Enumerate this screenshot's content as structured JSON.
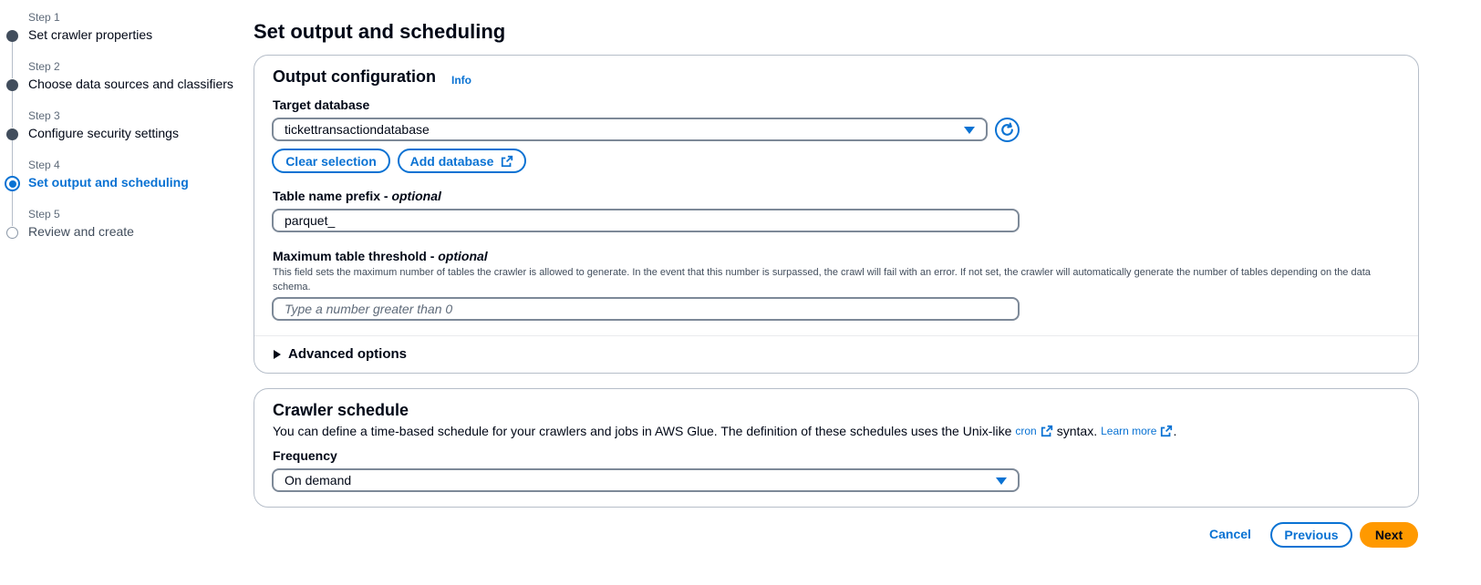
{
  "sidebar": {
    "steps": [
      {
        "number": "Step 1",
        "title": "Set crawler properties",
        "state": "done"
      },
      {
        "number": "Step 2",
        "title": "Choose data sources and classifiers",
        "state": "done"
      },
      {
        "number": "Step 3",
        "title": "Configure security settings",
        "state": "done"
      },
      {
        "number": "Step 4",
        "title": "Set output and scheduling",
        "state": "active"
      },
      {
        "number": "Step 5",
        "title": "Review and create",
        "state": "future"
      }
    ]
  },
  "page_title": "Set output and scheduling",
  "output_config": {
    "heading": "Output configuration",
    "info_link": "Info",
    "target_database": {
      "label": "Target database",
      "value": "tickettransactiondatabase"
    },
    "clear_selection_label": "Clear selection",
    "add_database_label": "Add database",
    "table_prefix": {
      "label": "Table name prefix - ",
      "optional": "optional",
      "value": "parquet_"
    },
    "max_threshold": {
      "label": "Maximum table threshold - ",
      "optional": "optional",
      "description": "This field sets the maximum number of tables the crawler is allowed to generate. In the event that this number is surpassed, the crawl will fail with an error. If not set, the crawler will automatically generate the number of tables depending on the data schema.",
      "placeholder": "Type a number greater than 0"
    },
    "advanced_options_label": "Advanced options"
  },
  "crawler_schedule": {
    "heading": "Crawler schedule",
    "description_prefix": "You can define a time-based schedule for your crawlers and jobs in AWS Glue. The definition of these schedules uses the Unix-like",
    "cron_link": "cron",
    "description_middle": "syntax.",
    "learn_more_link": "Learn more",
    "description_suffix": ".",
    "frequency": {
      "label": "Frequency",
      "value": "On demand"
    }
  },
  "footer": {
    "cancel_label": "Cancel",
    "previous_label": "Previous",
    "next_label": "Next"
  },
  "colors": {
    "accent": "#0972d3",
    "primary_button": "#ff9900",
    "text": "#000716",
    "border": "#7d8998"
  }
}
